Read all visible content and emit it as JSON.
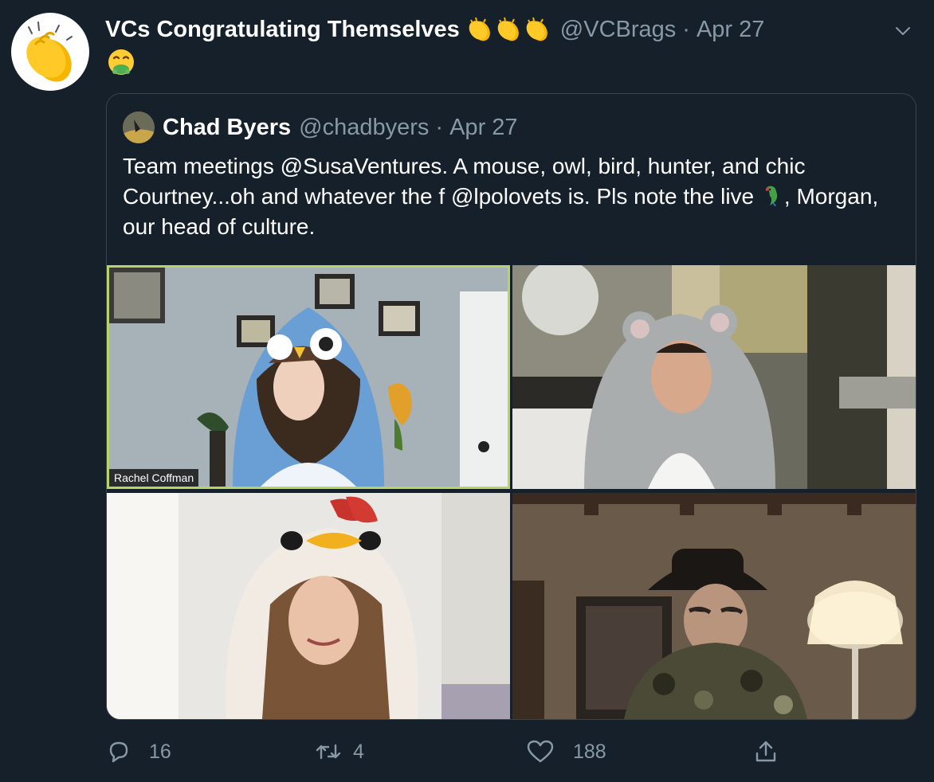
{
  "tweet": {
    "display_name": "VCs Congratulating Themselves",
    "handle": "@VCBrags",
    "separator": "·",
    "date": "Apr 27",
    "name_emoji": "clapping-hands-x3",
    "body_emoji": "face-vomiting"
  },
  "quoted_tweet": {
    "display_name": "Chad Byers",
    "handle": "@chadbyers",
    "separator": "·",
    "date": "Apr 27",
    "text_part1": "Team meetings @SusaVentures. A mouse, owl, bird, hunter, and chic Courtney...oh and whatever the f @lpolovets is. Pls note the live ",
    "text_emoji": "parrot",
    "text_part2": ", Morgan, our head of culture."
  },
  "media": {
    "name_tag": "Rachel Coffman",
    "active_speaker_color": "#b8d36b"
  },
  "actions": {
    "reply_count": "16",
    "retweet_count": "4",
    "like_count": "188",
    "share_icon": "share-icon"
  },
  "colors": {
    "background": "#15202b",
    "muted_text": "#8899a6",
    "border": "#38444d"
  }
}
